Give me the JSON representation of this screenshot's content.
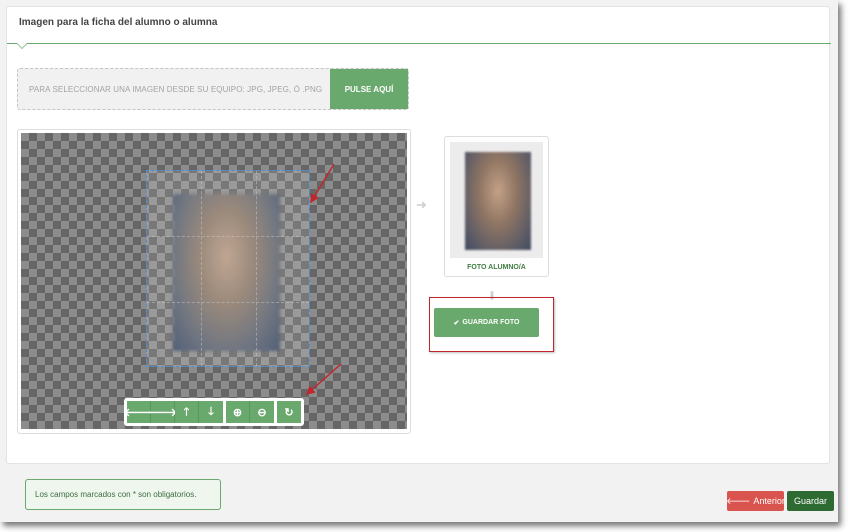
{
  "panel": {
    "title": "Imagen para la ficha del alumno o alumna"
  },
  "upload": {
    "hint": "PARA SELECCIONAR UNA IMAGEN DESDE SU EQUIPO: JPG, JPEG, Ó .PNG",
    "button_label": "PULSE AQUÍ"
  },
  "cropper": {
    "toolbar": [
      {
        "icon": "arrow-left-icon",
        "glyph": "🡐"
      },
      {
        "icon": "arrow-right-icon",
        "glyph": "🡒"
      },
      {
        "icon": "arrow-up-icon",
        "glyph": "🡑"
      },
      {
        "icon": "arrow-down-icon",
        "glyph": "🡓"
      },
      {
        "icon": "zoom-in-icon",
        "glyph": "⊕"
      },
      {
        "icon": "zoom-out-icon",
        "glyph": "⊖"
      },
      {
        "icon": "rotate-icon",
        "glyph": "↻"
      }
    ]
  },
  "preview": {
    "label": "FOTO ALUMNO/A",
    "arrow_right": "➜",
    "arrow_down": "⬇"
  },
  "save_photo": {
    "check": "✔",
    "label": "GUARDAR FOTO"
  },
  "footer": {
    "note": "Los campos marcados con * son obligatorios.",
    "prev_icon": "🡐",
    "prev_label": "Anterior",
    "save_label": "Guardar"
  },
  "colors": {
    "accent": "#6aa96d",
    "danger": "#d9534f",
    "dark_green": "#2e6b33",
    "annotation_red": "#c0272d"
  }
}
